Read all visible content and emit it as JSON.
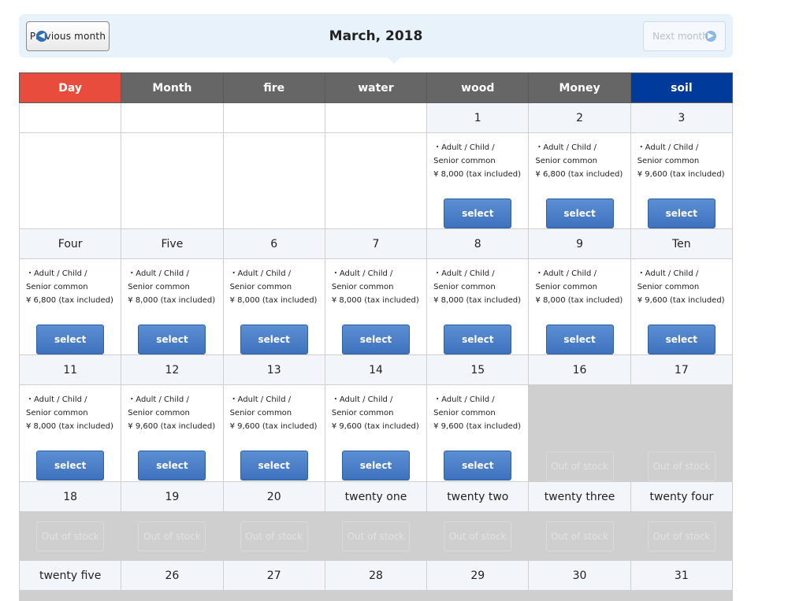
{
  "nav": {
    "prev_label": "Previous month",
    "next_label": "Next month",
    "title": "March, 2018"
  },
  "headers": [
    "Day",
    "Month",
    "fire",
    "water",
    "wood",
    "Money",
    "soil"
  ],
  "colors": {
    "sunday": "#e84c3d",
    "weekday": "#666666",
    "saturday": "#003a9a",
    "select": "#4a7ec7"
  },
  "weeks": [
    {
      "dates": [
        "",
        "",
        "",
        "",
        "1",
        "2",
        "3"
      ],
      "cells": [
        {
          "state": "empty"
        },
        {
          "state": "empty"
        },
        {
          "state": "empty"
        },
        {
          "state": "empty"
        },
        {
          "state": "available",
          "text": "・Adult / Child /\nSenior common\n¥ 8,000 (tax included)"
        },
        {
          "state": "available",
          "text": "・Adult / Child /\nSenior common\n¥ 6,800 (tax included)"
        },
        {
          "state": "available",
          "text": "・Adult / Child /\nSenior common\n¥ 9,600 (tax included)"
        }
      ]
    },
    {
      "dates": [
        "Four",
        "Five",
        "6",
        "7",
        "8",
        "9",
        "Ten"
      ],
      "cells": [
        {
          "state": "available",
          "text": "・Adult / Child /\nSenior common\n¥ 6,800 (tax included)"
        },
        {
          "state": "available",
          "text": "・Adult / Child /\nSenior common\n¥ 8,000 (tax included)"
        },
        {
          "state": "available",
          "text": "・Adult / Child /\nSenior common\n¥ 8,000 (tax included)"
        },
        {
          "state": "available",
          "text": "・Adult / Child /\nSenior common\n¥ 8,000 (tax included)"
        },
        {
          "state": "available",
          "text": "・Adult / Child /\nSenior common\n¥ 8,000 (tax included)"
        },
        {
          "state": "available",
          "text": "・Adult / Child /\nSenior common\n¥ 8,000 (tax included)"
        },
        {
          "state": "available",
          "text": "・Adult / Child /\nSenior common\n¥ 9,600 (tax included)"
        }
      ]
    },
    {
      "dates": [
        "11",
        "12",
        "13",
        "14",
        "15",
        "16",
        "17"
      ],
      "cells": [
        {
          "state": "available",
          "text": "・Adult / Child /\nSenior common\n¥ 8,000 (tax included)"
        },
        {
          "state": "available",
          "text": "・Adult / Child /\nSenior common\n¥ 9,600 (tax included)"
        },
        {
          "state": "available",
          "text": "・Adult / Child /\nSenior common\n¥ 9,600 (tax included)"
        },
        {
          "state": "available",
          "text": "・Adult / Child /\nSenior common\n¥ 9,600 (tax included)"
        },
        {
          "state": "available",
          "text": "・Adult / Child /\nSenior common\n¥ 9,600 (tax included)"
        },
        {
          "state": "soldout"
        },
        {
          "state": "soldout"
        }
      ]
    },
    {
      "dates": [
        "18",
        "19",
        "20",
        "twenty one",
        "twenty two",
        "twenty three",
        "twenty four"
      ],
      "cells": [
        {
          "state": "soldout"
        },
        {
          "state": "soldout"
        },
        {
          "state": "soldout"
        },
        {
          "state": "soldout"
        },
        {
          "state": "soldout"
        },
        {
          "state": "soldout"
        },
        {
          "state": "soldout"
        }
      ]
    },
    {
      "dates": [
        "twenty five",
        "26",
        "27",
        "28",
        "29",
        "30",
        "31"
      ],
      "cells": [
        {
          "state": "soldout"
        },
        {
          "state": "soldout"
        },
        {
          "state": "soldout"
        },
        {
          "state": "soldout"
        },
        {
          "state": "soldout"
        },
        {
          "state": "soldout"
        },
        {
          "state": "soldout"
        }
      ]
    }
  ],
  "labels": {
    "select": "select",
    "out_of_stock": "Out of stock"
  }
}
